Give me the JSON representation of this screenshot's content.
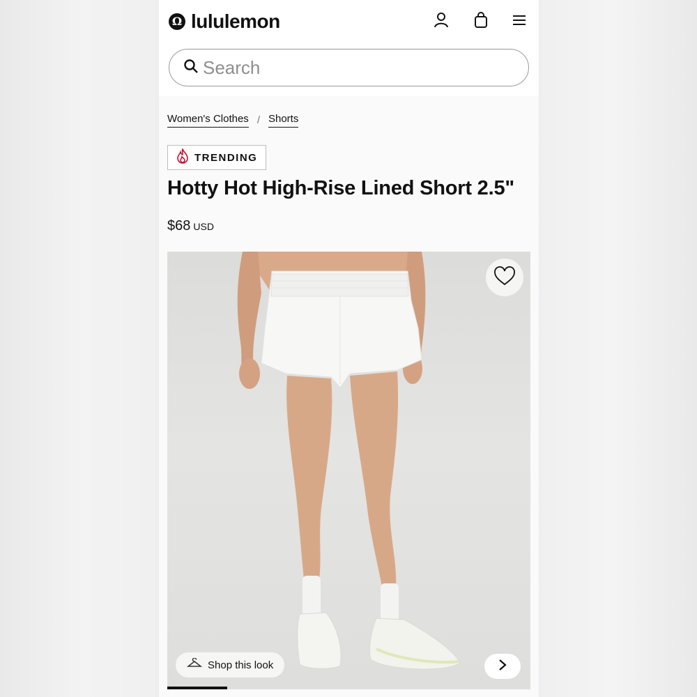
{
  "header": {
    "brand": "lululemon",
    "icons": [
      "account-icon",
      "bag-icon",
      "menu-icon"
    ]
  },
  "search": {
    "placeholder": "Search"
  },
  "breadcrumb": {
    "items": [
      "Women's Clothes",
      "Shorts"
    ],
    "separator": "/"
  },
  "badge": {
    "label": "TRENDING",
    "icon": "flame-icon"
  },
  "product": {
    "title": "Hotty Hot High-Rise Lined Short 2.5\"",
    "price": "$68",
    "currency": "USD"
  },
  "gallery": {
    "shop_look_label": "Shop this look",
    "progress": 0.166
  },
  "colors": {
    "accent": "#111111",
    "flame": "#c8102e"
  }
}
